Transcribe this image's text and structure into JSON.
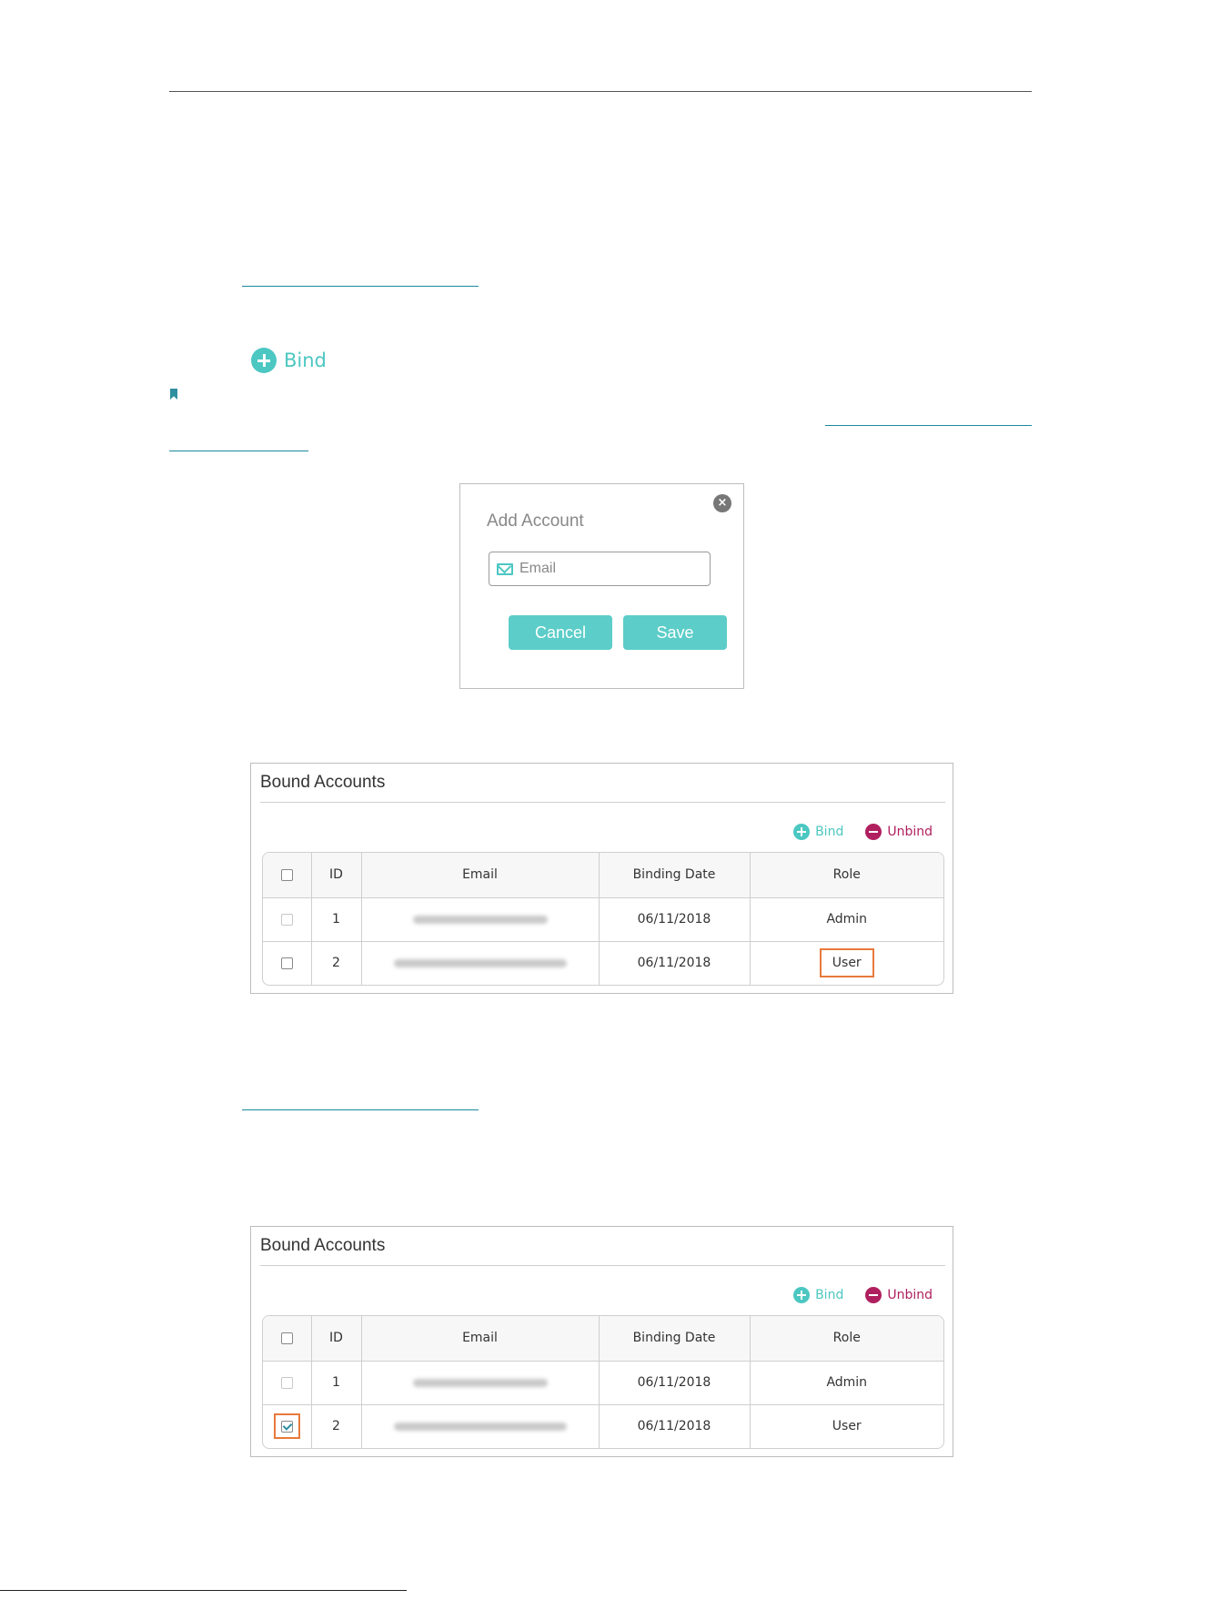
{
  "bind_link": {
    "icon": "plus-circle-icon",
    "label": "Bind"
  },
  "dialog": {
    "title": "Add Account",
    "email_placeholder": "Email",
    "cancel_label": "Cancel",
    "save_label": "Save"
  },
  "panels": [
    {
      "title": "Bound Accounts",
      "bind_label": "Bind",
      "unbind_label": "Unbind",
      "columns": [
        "ID",
        "Email",
        "Binding Date",
        "Role"
      ],
      "rows": [
        {
          "id": "1",
          "date": "06/11/2018",
          "role": "Admin",
          "checked": false,
          "disabled": true
        },
        {
          "id": "2",
          "date": "06/11/2018",
          "role": "User",
          "checked": false,
          "disabled": false
        }
      ]
    },
    {
      "title": "Bound Accounts",
      "bind_label": "Bind",
      "unbind_label": "Unbind",
      "columns": [
        "ID",
        "Email",
        "Binding Date",
        "Role"
      ],
      "rows": [
        {
          "id": "1",
          "date": "06/11/2018",
          "role": "Admin",
          "checked": false,
          "disabled": true
        },
        {
          "id": "2",
          "date": "06/11/2018",
          "role": "User",
          "checked": true,
          "disabled": false
        }
      ]
    }
  ],
  "colors": {
    "accent": "#4cc7c2",
    "unbind": "#b0205f",
    "highlight": "#e8793b"
  }
}
